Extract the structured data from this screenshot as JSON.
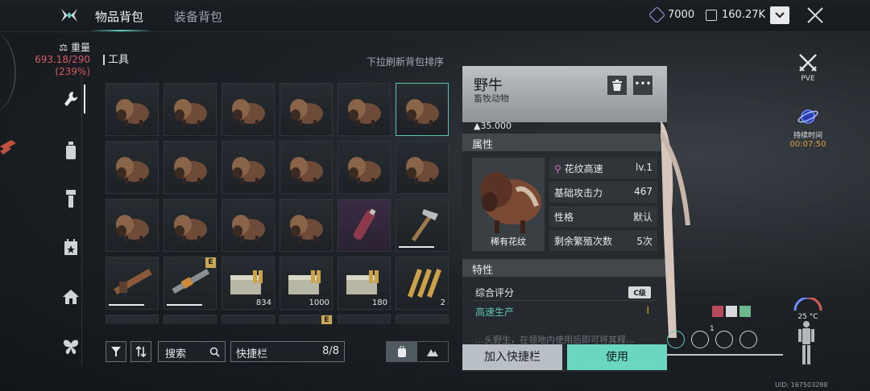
{
  "header": {
    "tabs": [
      {
        "label": "物品背包",
        "active": true
      },
      {
        "label": "装备背包",
        "active": false
      }
    ],
    "currency_1": "7000",
    "currency_2": "160.27K"
  },
  "sidebar": {
    "weight_label": "重量",
    "weight_value": "693.18/290",
    "weight_percent": "(239%)",
    "items": [
      {
        "icon": "wrench-icon",
        "active": true
      },
      {
        "icon": "bottle-icon",
        "active": false
      },
      {
        "icon": "tool-icon",
        "active": false
      },
      {
        "icon": "calendar-star-icon",
        "active": false
      },
      {
        "icon": "house-icon",
        "active": false
      },
      {
        "icon": "butterfly-icon",
        "active": false
      }
    ]
  },
  "inventory": {
    "section_title": "工具",
    "sort_hint": "下拉刷新背包排序",
    "cells": [
      {
        "type": "bison"
      },
      {
        "type": "bison"
      },
      {
        "type": "bison"
      },
      {
        "type": "bison"
      },
      {
        "type": "bison"
      },
      {
        "type": "bison",
        "selected": true
      },
      {
        "type": "bison"
      },
      {
        "type": "bison"
      },
      {
        "type": "bison"
      },
      {
        "type": "bison"
      },
      {
        "type": "bison"
      },
      {
        "type": "bison"
      },
      {
        "type": "bison"
      },
      {
        "type": "bison"
      },
      {
        "type": "bison"
      },
      {
        "type": "bison"
      },
      {
        "type": "flask"
      },
      {
        "type": "hammer"
      },
      {
        "type": "gun1"
      },
      {
        "type": "gun2",
        "badge": "E"
      },
      {
        "type": "ammo",
        "count": "834"
      },
      {
        "type": "ammo",
        "count": "1000"
      },
      {
        "type": "ammo",
        "count": "180"
      },
      {
        "type": "bullets",
        "count": "2"
      }
    ],
    "partial_badge": "E"
  },
  "toolbar": {
    "search_label": "搜索",
    "quickbar_label": "快捷栏",
    "quickbar_count": "8/8"
  },
  "detail": {
    "name": "野牛",
    "category": "畜牧动物",
    "weight": "35.000",
    "attributes_title": "属性",
    "image_label": "稀有花纹",
    "attributes": [
      {
        "label": "花纹高速",
        "value": "lv.1"
      },
      {
        "label": "基础攻击力",
        "value": "467"
      },
      {
        "label": "性格",
        "value": "默认"
      },
      {
        "label": "剩余繁殖次数",
        "value": "5次"
      }
    ],
    "traits_title": "特性",
    "traits": [
      {
        "label": "综合评分",
        "value": "C级"
      },
      {
        "label": "高速生产",
        "value": "I"
      }
    ],
    "description": "…头野生，在领地内使用后即可将其释…",
    "add_quickbar": "加入快捷栏",
    "use": "使用"
  },
  "right_hud": {
    "mode": "PVE",
    "duration_label": "持续时间",
    "duration_time": "00:07:50",
    "temperature": "25 °C",
    "count_indicator": "1",
    "uid": "UID: 167503288"
  },
  "colors": {
    "accent": "#5ec5b4",
    "use_button": "#6bd7c1",
    "weight_warning": "#d35b63",
    "purple_currency": "#b59df1",
    "timer": "#d9a441"
  }
}
